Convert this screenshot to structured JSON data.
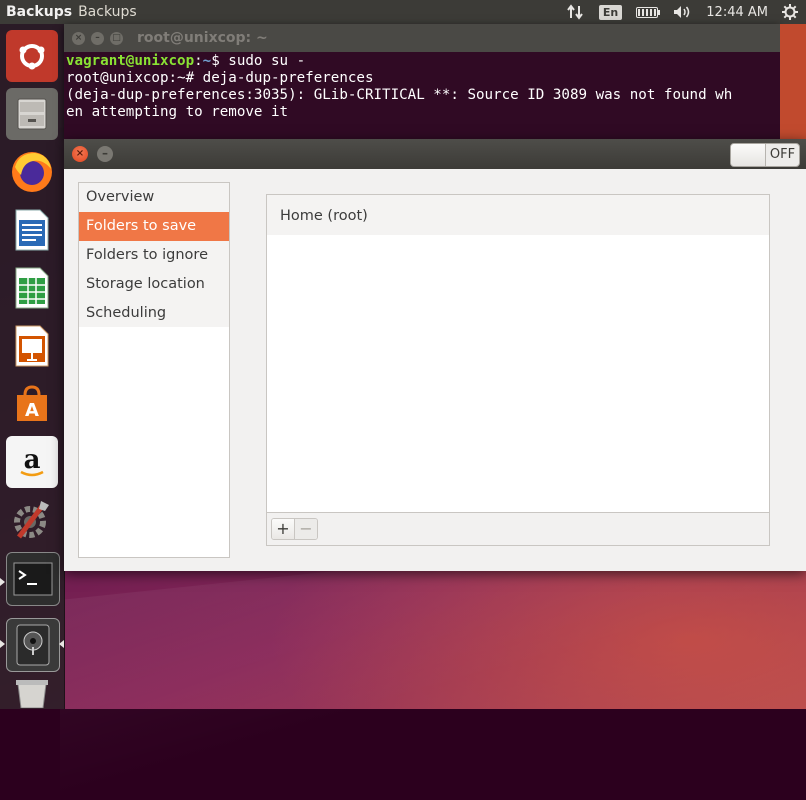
{
  "top_panel": {
    "app_name": "Backups",
    "window_title": "Backups",
    "language": "En",
    "clock": "12:44 AM",
    "icons": [
      "network-arrows-icon",
      "battery-icon",
      "volume-icon",
      "gear-icon"
    ]
  },
  "launcher": {
    "items": [
      "ubuntu-dash",
      "files",
      "firefox",
      "libreoffice-writer",
      "libreoffice-calc",
      "libreoffice-impress",
      "software-center",
      "amazon",
      "system-settings",
      "terminal",
      "backups",
      "trash"
    ]
  },
  "terminal": {
    "title": "root@unixcop: ~",
    "line1_user": "vagrant@unixcop",
    "line1_sep": ":",
    "line1_path": "~",
    "line1_rest": "$ sudo su -",
    "line2": "root@unixcop:~# deja-dup-preferences",
    "line3": "",
    "line4": "(deja-dup-preferences:3035): GLib-CRITICAL **: Source ID 3089 was not found wh",
    "line5": "en attempting to remove it"
  },
  "backups_window": {
    "switch_state": "OFF",
    "sidebar": {
      "items": [
        {
          "label": "Overview"
        },
        {
          "label": "Folders to save"
        },
        {
          "label": "Folders to ignore"
        },
        {
          "label": "Storage location"
        },
        {
          "label": "Scheduling"
        }
      ],
      "selected": "Folders to save"
    },
    "folders": [
      "Home (root)"
    ],
    "add_label": "+",
    "remove_label": "−"
  },
  "colors": {
    "accent": "#f07746",
    "terminal_bg": "#300a24",
    "panel_bg": "#3c3b37"
  }
}
